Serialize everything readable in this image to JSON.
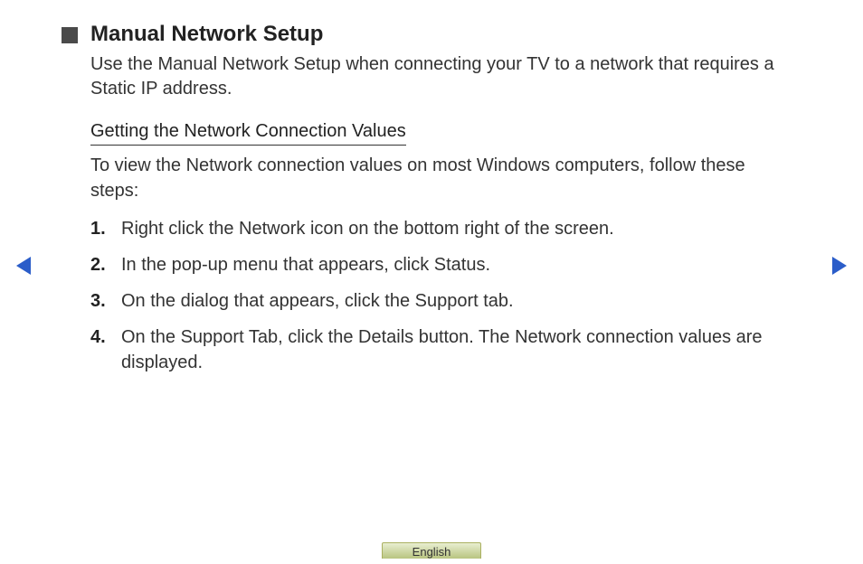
{
  "title": "Manual Network Setup",
  "intro": "Use the Manual Network Setup when connecting your TV to a network that requires a Static IP address.",
  "subheading": "Getting the Network Connection Values",
  "subintro": "To view the Network connection values on most Windows computers, follow these steps:",
  "steps": [
    "Right click the Network icon on the bottom right of the screen.",
    "In the pop-up menu that appears, click Status.",
    "On the dialog that appears, click the Support tab.",
    "On the Support Tab, click the Details button. The Network connection values are displayed."
  ],
  "step_numbers": [
    "1.",
    "2.",
    "3.",
    "4."
  ],
  "language": "English",
  "colors": {
    "arrow": "#2b5dc9"
  }
}
